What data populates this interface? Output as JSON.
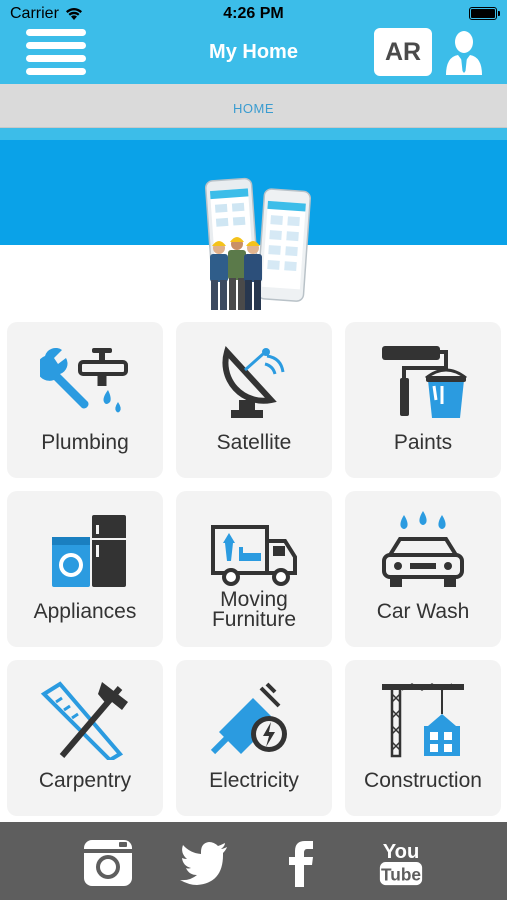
{
  "status": {
    "carrier": "Carrier",
    "time": "4:26 PM"
  },
  "header": {
    "title": "My Home",
    "ar_label": "AR",
    "menu_icon": "hamburger-menu-icon",
    "profile_icon": "user-profile-icon"
  },
  "breadcrumb": {
    "label": "HOME"
  },
  "colors": {
    "header": "#3cbde9",
    "banner": "#0aa2e8",
    "accent": "#3a9cd0",
    "footer": "#5e5e5e",
    "icon_dark": "#333333",
    "icon_blue": "#2b9be0"
  },
  "services": [
    {
      "label": "Plumbing",
      "icon": "plumbing-icon"
    },
    {
      "label": "Satellite",
      "icon": "satellite-icon"
    },
    {
      "label": "Paints",
      "icon": "paint-roller-icon"
    },
    {
      "label": "Appliances",
      "icon": "appliances-icon"
    },
    {
      "label_line1": "Moving",
      "label_line2": "Furniture",
      "icon": "moving-truck-icon"
    },
    {
      "label": "Car Wash",
      "icon": "car-wash-icon"
    },
    {
      "label": "Carpentry",
      "icon": "carpentry-tools-icon"
    },
    {
      "label": "Electricity",
      "icon": "electric-plug-icon"
    },
    {
      "label": "Construction",
      "icon": "construction-crane-icon"
    }
  ],
  "footer": {
    "social": [
      "instagram-icon",
      "twitter-icon",
      "facebook-icon",
      "youtube-icon"
    ],
    "youtube_top": "You",
    "youtube_bottom": "Tube"
  }
}
